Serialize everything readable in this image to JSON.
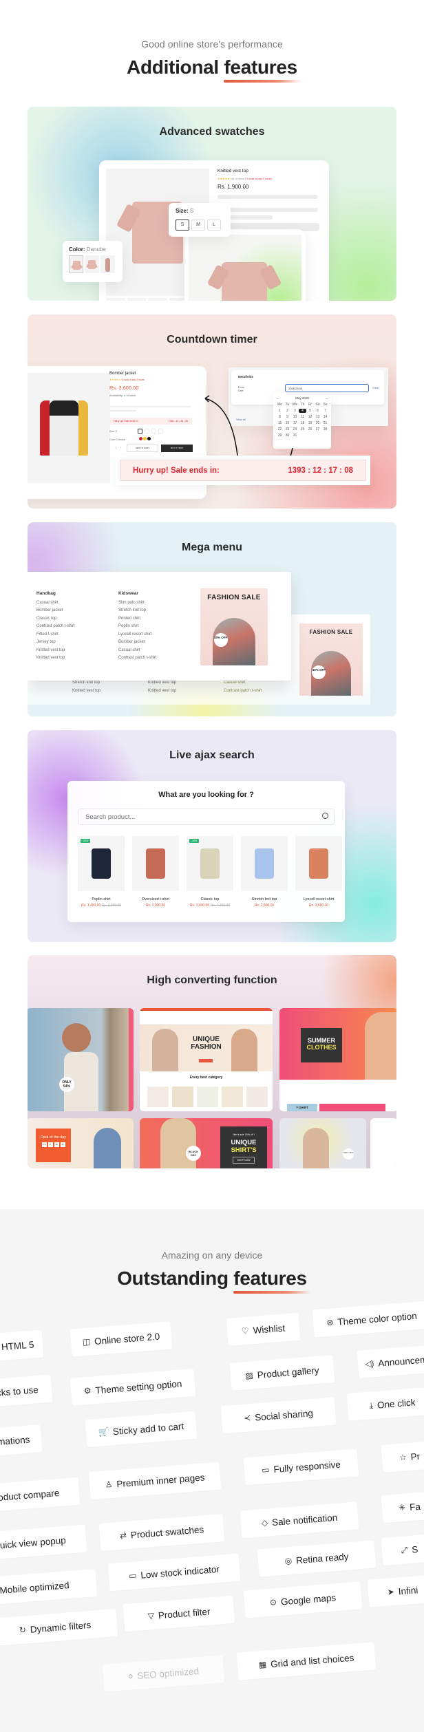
{
  "additional": {
    "subtitle": "Good online store's performance",
    "title_main": "Additional",
    "title_highlight": "features",
    "accent": "#e0573a"
  },
  "swatches": {
    "title": "Advanced swatches",
    "product_name": "Knitted vest top",
    "reviews": "No reviews",
    "sold_note": "9 sold in last 2 hours",
    "price": "Rs. 1,900.00",
    "size_label": "Size:",
    "size_value": "S",
    "sizes": [
      "S",
      "M",
      "L"
    ],
    "color_label": "Color:",
    "color_value": "Danube"
  },
  "countdown": {
    "title": "Countdown timer",
    "product_name": "Bomber jacket",
    "sold_note": "6 sold in last 2 hours",
    "price": "Rs. 3,600.00",
    "availability_label": "Availability:",
    "availability_value": "In stock",
    "mini_banner_label": "Hurry up! Sale ends in:",
    "mini_banner_time": "1482 : 13 : 43 : 25",
    "size_label": "Size: S",
    "color_label": "Color: Crimson",
    "qty": "1",
    "add_to_cart": "ADD TO CART",
    "buy_now": "BUY IT NOW",
    "metafields_title": "Metafields",
    "field_label_1": "Email",
    "field_label_2": "Date",
    "date_value": "2028-05-04",
    "clear_label": "Clear",
    "view_all": "View all",
    "calendar_month": "May 2028",
    "weekdays": [
      "Mo",
      "Tu",
      "We",
      "Th",
      "Fr",
      "Sa",
      "Su"
    ],
    "selected_day": "4",
    "banner_label": "Hurry up! Sale ends in:",
    "banner_time": "1393 : 12 : 17 : 08",
    "alert_color": "#d9262e"
  },
  "mega_menu": {
    "title": "Mega menu",
    "col1_heading": "Handbag",
    "col1_items": [
      "Casual shirt",
      "Bomber jacket",
      "Classic top",
      "Contrast patch t-shirt",
      "Fitted t-shirt",
      "Jersey top",
      "Knitted vest top",
      "Knitted vest top"
    ],
    "col2_heading": "Kidswear",
    "col2_items": [
      "Slim polo shirt",
      "Stretch knit top",
      "Printed shirt",
      "Poplin shirt",
      "Lyocell resort shirt",
      "Bomber jacket",
      "Casual shirt",
      "Contrast patch t-shirt"
    ],
    "back_col1": [
      "Stretch knit top",
      "Knitted vest top"
    ],
    "back_col2": [
      "Knitted vest top",
      "Knitted vest top"
    ],
    "back_col3": [
      "Casual shirt",
      "Contrast patch t-shirt"
    ],
    "promo_label": "FASHION SALE",
    "promo_badge": "30% OFF"
  },
  "ajax_search": {
    "title": "Live ajax search",
    "heading": "What are you looking for ?",
    "placeholder": "Search product...",
    "products": [
      {
        "name": "Poplin shirt",
        "price": "Rs. 1,400.00",
        "old_price": "Rs. 3,000.00",
        "badge": "-53%",
        "color": "#1e2738"
      },
      {
        "name": "Oversized t-shirt",
        "price": "Rs. 2,000.00",
        "old_price": "",
        "badge": "",
        "color": "#c46a55"
      },
      {
        "name": "Classic top",
        "price": "Rs. 2,600.00",
        "old_price": "Rs. 4,300.00",
        "badge": "-40%",
        "color": "#d9d3b8"
      },
      {
        "name": "Stretch knit top",
        "price": "Rs. 2,600.00",
        "old_price": "",
        "badge": "",
        "color": "#a9c4ec"
      },
      {
        "name": "Lyocell resort shirt",
        "price": "Rs. 3,600.00",
        "old_price": "",
        "badge": "",
        "color": "#d9825f"
      }
    ]
  },
  "high_converting": {
    "title": "High converting function",
    "shot1_badge": "ONLY 54%",
    "shot2_headline_1": "UNIQUE",
    "shot2_headline_2": "FASHION",
    "shot2_section": "Every best category",
    "shot3_headline_1": "SUMMER",
    "shot3_headline_2": "CLOTHES",
    "shot3_tag": "T-SHIRT",
    "shot4_headline": "Deal of the day",
    "shot4_timer": [
      "174",
      "8",
      "38",
      "31"
    ],
    "shot5_promo": "Men's sale 20% off !",
    "shot5_headline_1": "UNIQUE",
    "shot5_headline_2": "SHIRT'S",
    "shot5_badge": "BLACK DAY",
    "shot5_cta": "SHOP NOW",
    "shot6_badge": "ONLY 25%"
  },
  "outstanding": {
    "subtitle": "Amazing on any device",
    "title_main": "Outstanding",
    "title_highlight": "features",
    "features": [
      {
        "label": "HTML 5",
        "icon": "html5-icon",
        "glyph": "▣"
      },
      {
        "label": "Online store 2.0",
        "icon": "bag-icon",
        "glyph": "◫"
      },
      {
        "label": "Wishlist",
        "icon": "heart-icon",
        "glyph": "♡"
      },
      {
        "label": "Theme color option",
        "icon": "palette-icon",
        "glyph": "⊛"
      },
      {
        "label": "Clicks to use",
        "icon": "cursor-icon",
        "glyph": ""
      },
      {
        "label": "Theme setting option",
        "icon": "gear-icon",
        "glyph": "⚙"
      },
      {
        "label": "Product gallery",
        "icon": "image-icon",
        "glyph": "▨"
      },
      {
        "label": "Announcement",
        "icon": "speaker-icon",
        "glyph": "◁)"
      },
      {
        "label": "Animations",
        "icon": "sparkle-icon",
        "glyph": ""
      },
      {
        "label": "Sticky add to cart",
        "icon": "cart-icon",
        "glyph": "🛒"
      },
      {
        "label": "Social sharing",
        "icon": "share-icon",
        "glyph": "≺"
      },
      {
        "label": "One click",
        "icon": "download-icon",
        "glyph": "⤓"
      },
      {
        "label": "Product compare",
        "icon": "compare-icon",
        "glyph": ""
      },
      {
        "label": "Premium inner pages",
        "icon": "award-icon",
        "glyph": "♙"
      },
      {
        "label": "Fully responsive",
        "icon": "monitor-icon",
        "glyph": "▭"
      },
      {
        "label": "Pr",
        "icon": "star-icon",
        "glyph": "☆"
      },
      {
        "label": "Quick view popup",
        "icon": "eye-icon",
        "glyph": ""
      },
      {
        "label": "Product swatches",
        "icon": "repeat-icon",
        "glyph": "⇄"
      },
      {
        "label": "Sale notification",
        "icon": "tag-icon",
        "glyph": "◇"
      },
      {
        "label": "Fa",
        "icon": "loader-icon",
        "glyph": "✳"
      },
      {
        "label": "Mobile optimized",
        "icon": "mobile-icon",
        "glyph": ""
      },
      {
        "label": "Low stock indicator",
        "icon": "battery-icon",
        "glyph": "▭"
      },
      {
        "label": "Retina ready",
        "icon": "eye-icon",
        "glyph": "◎"
      },
      {
        "label": "S",
        "icon": "expand-icon",
        "glyph": "⤢"
      },
      {
        "label": "Dynamic filters",
        "icon": "refresh-icon",
        "glyph": "↻"
      },
      {
        "label": "Product filter",
        "icon": "filter-icon",
        "glyph": "▽"
      },
      {
        "label": "Google maps",
        "icon": "map-pin-icon",
        "glyph": "⊙"
      },
      {
        "label": "Infini",
        "icon": "pointer-icon",
        "glyph": "➤"
      },
      {
        "label": "SEO optimized",
        "icon": "search-icon",
        "glyph": "○"
      },
      {
        "label": "Grid and list choices",
        "icon": "grid-icon",
        "glyph": "▦"
      }
    ]
  }
}
